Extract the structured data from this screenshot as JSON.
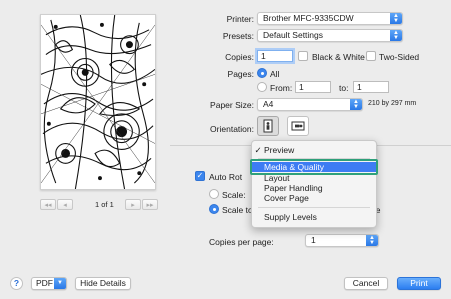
{
  "preview": {
    "page_indicator": "1 of 1",
    "first_label": "◂◂",
    "prev_label": "◂",
    "next_label": "▸",
    "last_label": "▸▸"
  },
  "printer": {
    "label": "Printer:",
    "value": "Brother MFC-9335CDW"
  },
  "presets": {
    "label": "Presets:",
    "value": "Default Settings"
  },
  "copies": {
    "label": "Copies:",
    "value": "1",
    "bw_label": "Black & White",
    "two_sided_label": "Two-Sided"
  },
  "pages": {
    "label": "Pages:",
    "all_label": "All",
    "from_label": "From:",
    "from_value": "1",
    "to_label": "to:",
    "to_value": "1"
  },
  "paper_size": {
    "label": "Paper Size:",
    "value": "A4",
    "dimensions": "210 by 297 mm"
  },
  "orientation": {
    "label": "Orientation:"
  },
  "section_menu": {
    "items": [
      {
        "label": "Preview",
        "checked": true
      },
      {
        "label": "Media & Quality",
        "highlighted": true
      },
      {
        "label": "Layout"
      },
      {
        "label": "Paper Handling"
      },
      {
        "label": "Cover Page"
      },
      {
        "label": "Supply Levels"
      }
    ],
    "check_glyph": "✓"
  },
  "auto_rotate": {
    "label": "Auto Rot"
  },
  "scale": {
    "label": "Scale:"
  },
  "scale_to_fit": {
    "label": "Scale to",
    "suffix": "ge"
  },
  "copies_per_page": {
    "label": "Copies per page:",
    "value": "1"
  },
  "footer": {
    "help_label": "?",
    "pdf_label": "PDF",
    "hide_details_label": "Hide Details",
    "cancel_label": "Cancel",
    "print_label": "Print"
  },
  "colors": {
    "accent": "#3c86ee",
    "highlight_frame": "#2ea07a",
    "menu_selection": "#3d7cf3"
  }
}
